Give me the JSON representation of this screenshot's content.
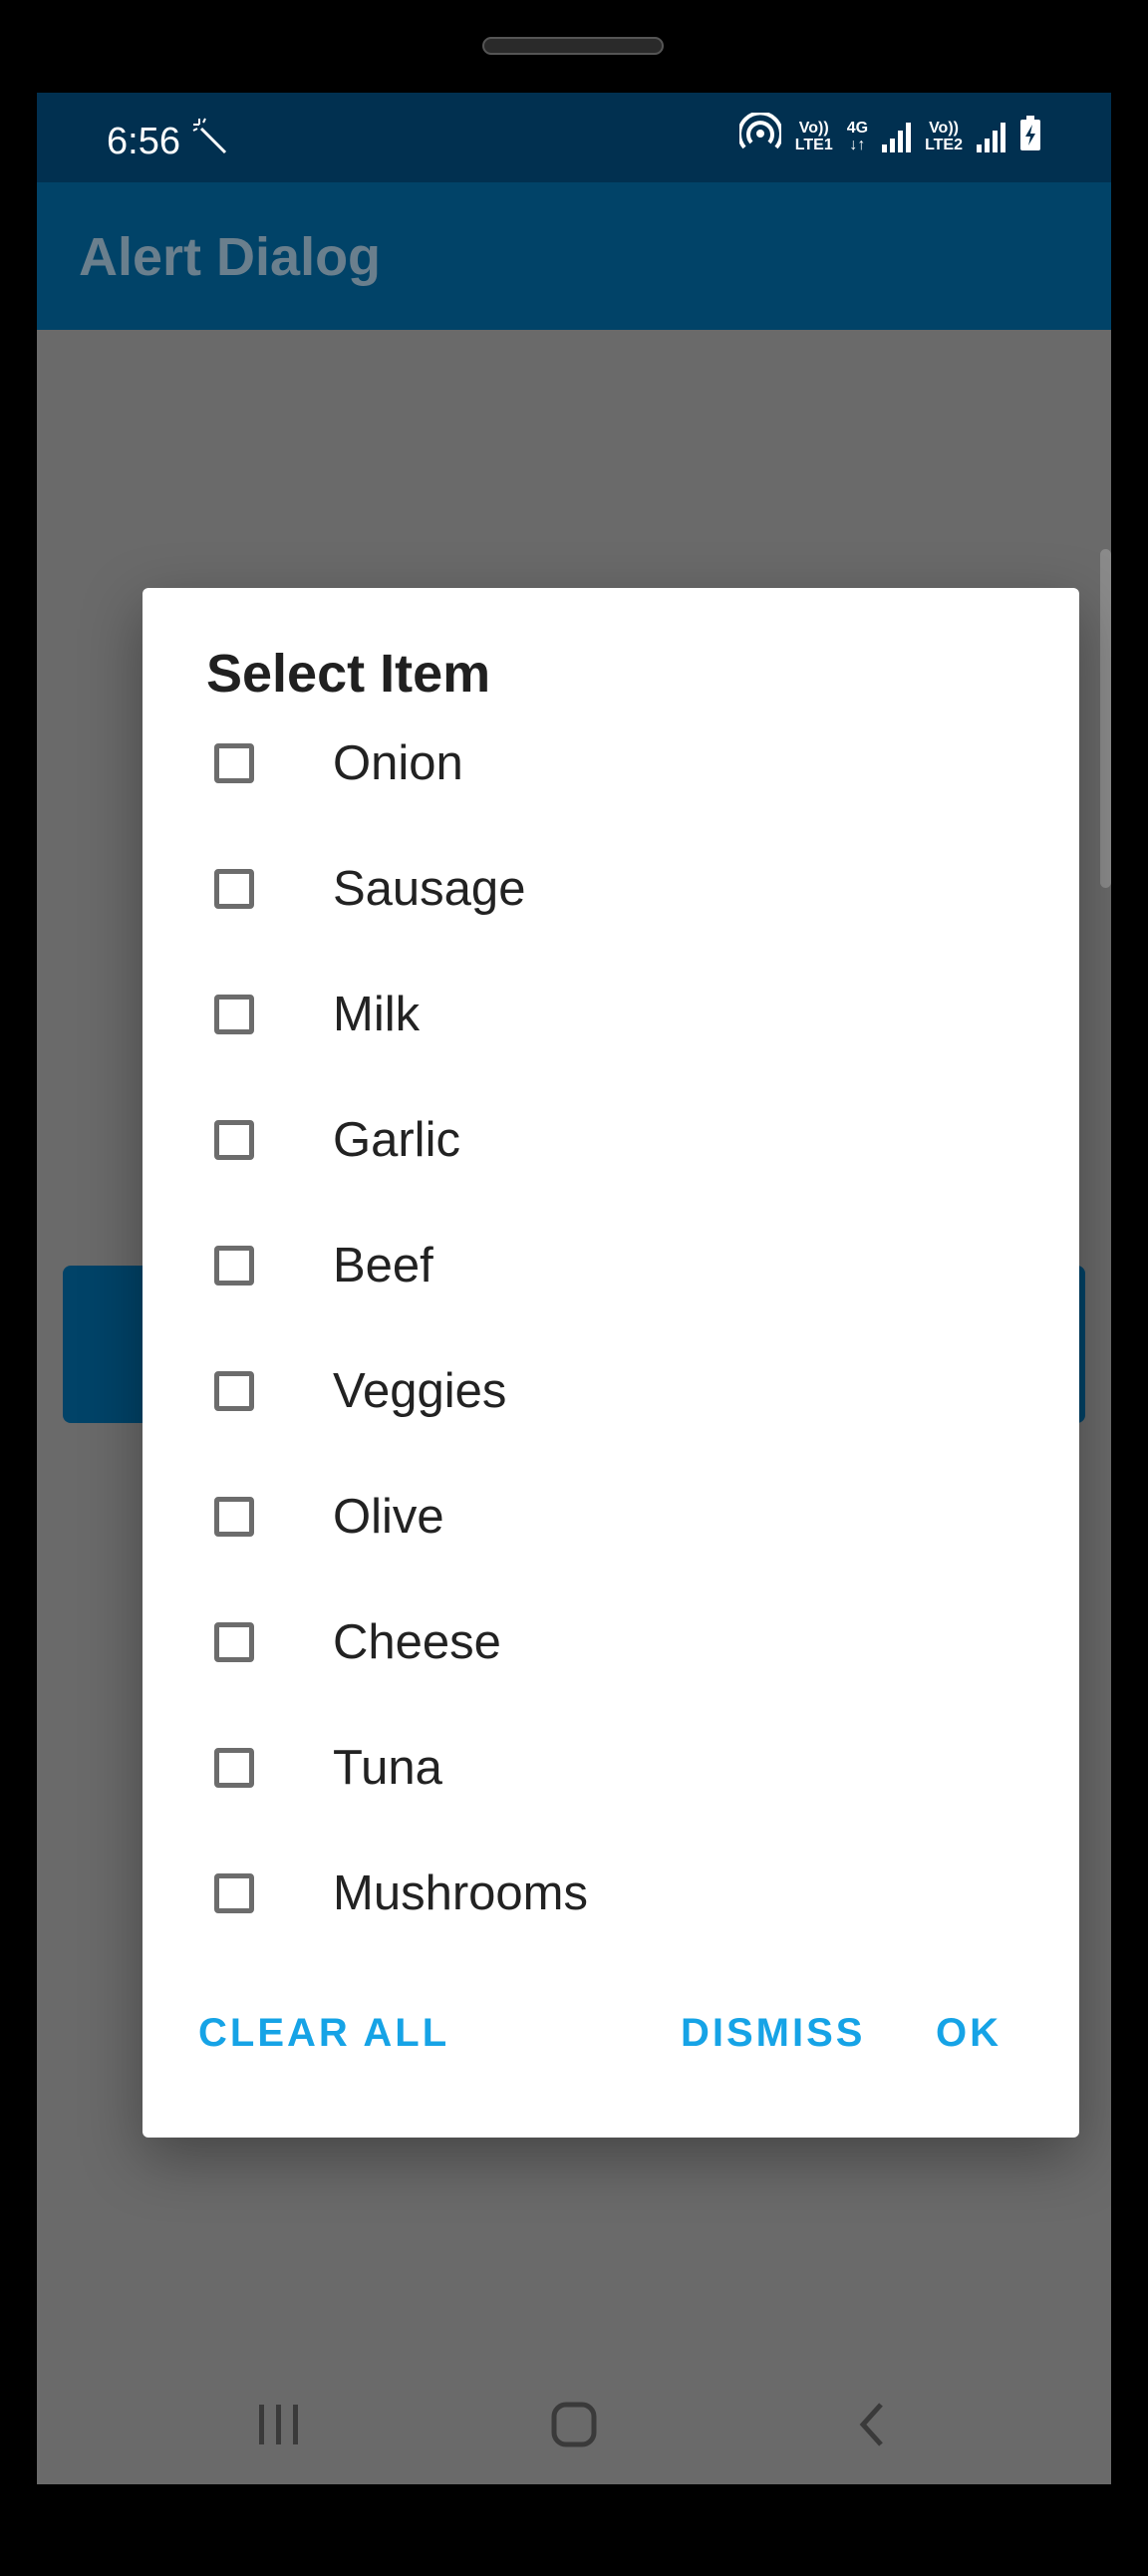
{
  "status_bar": {
    "time": "6:56",
    "sim1_label_top": "Vo))",
    "sim1_label_bottom": "LTE1",
    "network_type": "4G",
    "sim2_label_top": "Vo))",
    "sim2_label_bottom": "LTE2"
  },
  "app_bar": {
    "title": "Alert Dialog"
  },
  "dialog": {
    "title": "Select Item",
    "items": [
      {
        "label": "Onion",
        "checked": false
      },
      {
        "label": "Sausage",
        "checked": false
      },
      {
        "label": "Milk",
        "checked": false
      },
      {
        "label": "Garlic",
        "checked": false
      },
      {
        "label": "Beef",
        "checked": false
      },
      {
        "label": "Veggies",
        "checked": false
      },
      {
        "label": "Olive",
        "checked": false
      },
      {
        "label": "Cheese",
        "checked": false
      },
      {
        "label": "Tuna",
        "checked": false
      },
      {
        "label": "Mushrooms",
        "checked": false
      }
    ],
    "clear_all_label": "CLEAR ALL",
    "dismiss_label": "DISMISS",
    "ok_label": "OK"
  },
  "colors": {
    "status_bar": "#013050",
    "app_bar": "#014368",
    "accent": "#16a3e6",
    "scrim_background": "#6a6a6a"
  }
}
